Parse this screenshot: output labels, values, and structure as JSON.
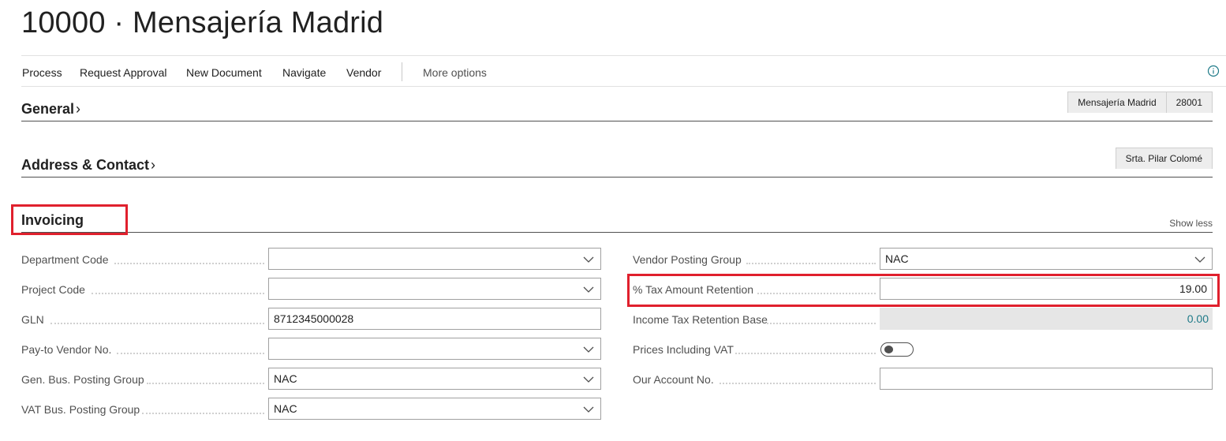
{
  "page": {
    "title": "10000 · Mensajería Madrid"
  },
  "actions": {
    "process": "Process",
    "request_approval": "Request Approval",
    "new_document": "New Document",
    "navigate": "Navigate",
    "vendor": "Vendor",
    "more_options": "More options",
    "info_icon": "info-icon"
  },
  "sections": {
    "general": {
      "title": "General",
      "summary": [
        "Mensajería Madrid",
        "28001"
      ]
    },
    "address": {
      "title": "Address & Contact",
      "summary": [
        "Srta. Pilar Colomé"
      ]
    },
    "invoicing": {
      "title": "Invoicing",
      "show_less": "Show less"
    }
  },
  "fields_left": [
    {
      "label": "Department Code",
      "value": "",
      "type": "dropdown"
    },
    {
      "label": "Project Code",
      "value": "",
      "type": "dropdown"
    },
    {
      "label": "GLN",
      "value": "8712345000028",
      "type": "text"
    },
    {
      "label": "Pay-to Vendor No.",
      "value": "",
      "type": "dropdown"
    },
    {
      "label": "Gen. Bus. Posting Group",
      "value": "NAC",
      "type": "dropdown"
    },
    {
      "label": "VAT Bus. Posting Group",
      "value": "NAC",
      "type": "dropdown"
    }
  ],
  "fields_right": [
    {
      "label": "Vendor Posting Group",
      "value": "NAC",
      "type": "dropdown"
    },
    {
      "label": "% Tax Amount Retention",
      "value": "19.00",
      "type": "number"
    },
    {
      "label": "Income Tax Retention Base",
      "value": "0.00",
      "type": "readonly"
    },
    {
      "label": "Prices Including VAT",
      "value": "off",
      "type": "toggle"
    },
    {
      "label": "Our Account No.",
      "value": "",
      "type": "text"
    }
  ],
  "colors": {
    "highlight": "#e0202d",
    "readonly_value": "#1e7a88",
    "info_icon": "#1e7a88"
  }
}
